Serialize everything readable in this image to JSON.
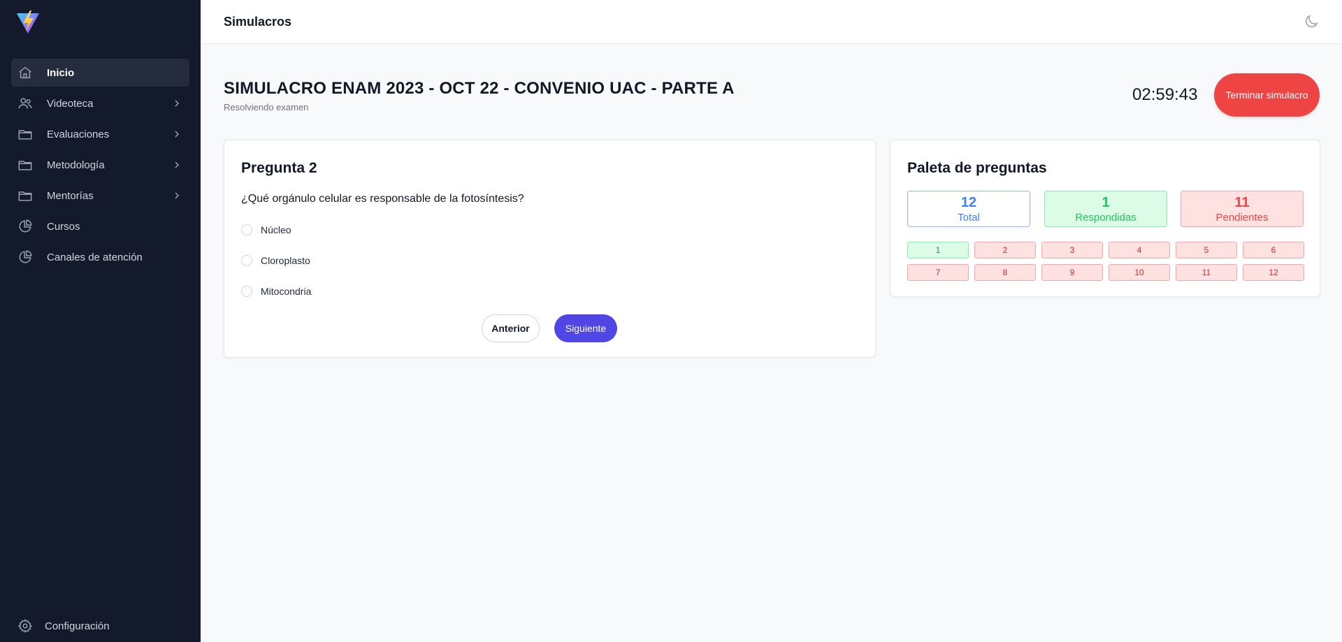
{
  "sidebar": {
    "items": [
      {
        "label": "Inicio",
        "icon": "home-icon",
        "active": true,
        "has_chevron": false
      },
      {
        "label": "Videoteca",
        "icon": "users-icon",
        "active": false,
        "has_chevron": true
      },
      {
        "label": "Evaluaciones",
        "icon": "folder-icon",
        "active": false,
        "has_chevron": true
      },
      {
        "label": "Metodología",
        "icon": "folder-icon",
        "active": false,
        "has_chevron": true
      },
      {
        "label": "Mentorías",
        "icon": "folder-icon",
        "active": false,
        "has_chevron": true
      },
      {
        "label": "Cursos",
        "icon": "pie-chart-icon",
        "active": false,
        "has_chevron": false
      },
      {
        "label": "Canales de atención",
        "icon": "pie-chart-icon",
        "active": false,
        "has_chevron": false
      }
    ],
    "config_label": "Configuración"
  },
  "topbar": {
    "title": "Simulacros"
  },
  "exam": {
    "title": "SIMULACRO ENAM 2023 - OCT 22 - CONVENIO UAC - PARTE A",
    "subtitle": "Resolviendo examen",
    "timer": "02:59:43",
    "end_label": "Terminar simulacro"
  },
  "question": {
    "title": "Pregunta 2",
    "text": "¿Qué orgánulo celular es responsable de la fotosíntesis?",
    "options": [
      "Núcleo",
      "Cloroplasto",
      "Mitocondria"
    ],
    "prev_label": "Anterior",
    "next_label": "Siguiente"
  },
  "palette": {
    "title": "Paleta de preguntas",
    "total": {
      "value": "12",
      "label": "Total"
    },
    "answered": {
      "value": "1",
      "label": "Respondidas"
    },
    "pending": {
      "value": "11",
      "label": "Pendientes"
    },
    "questions": [
      {
        "n": "1",
        "status": "answered"
      },
      {
        "n": "2",
        "status": "pending"
      },
      {
        "n": "3",
        "status": "pending"
      },
      {
        "n": "4",
        "status": "pending"
      },
      {
        "n": "5",
        "status": "pending"
      },
      {
        "n": "6",
        "status": "pending"
      },
      {
        "n": "7",
        "status": "pending"
      },
      {
        "n": "8",
        "status": "pending"
      },
      {
        "n": "9",
        "status": "pending"
      },
      {
        "n": "10",
        "status": "pending"
      },
      {
        "n": "11",
        "status": "pending"
      },
      {
        "n": "12",
        "status": "pending"
      }
    ]
  },
  "colors": {
    "sidebar_bg": "#131a2c",
    "primary": "#4f46e5",
    "danger": "#ef4444",
    "success": "#22c55e",
    "info": "#3b82f6"
  }
}
